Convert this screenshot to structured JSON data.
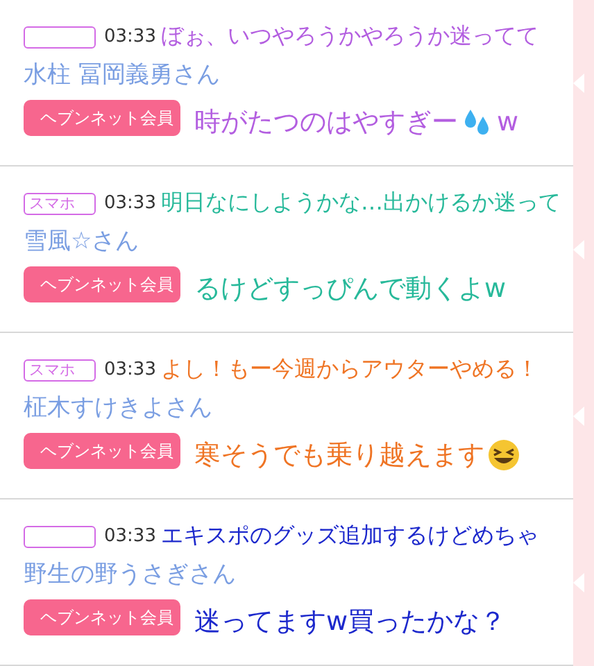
{
  "rows": [
    {
      "badge": null,
      "time": "03:33",
      "name": "水柱 冨岡義勇さん",
      "button": "ヘブンネット会員",
      "color": "#b35ee0",
      "overlay": [
        {
          "kind": "plain",
          "text": "ぼぉ、いつやろうかやろうか迷ってて"
        },
        {
          "kind": "droplets",
          "text": "時がたつのはやすぎー",
          "after": "w"
        }
      ]
    },
    {
      "badge": "スマホ",
      "time": "03:33",
      "name": "雪風☆さん",
      "button": "ヘブンネット会員",
      "color": "#27b99a",
      "overlay": [
        {
          "kind": "plain",
          "text": "明日なにしようかな…出かけるか迷って"
        },
        {
          "kind": "plain",
          "text": "るけどすっぴんで動くよw"
        }
      ]
    },
    {
      "badge": "スマホ",
      "time": "03:33",
      "name": "柾木すけきよさん",
      "button": "ヘブンネット会員",
      "color": "#ef7424",
      "overlay": [
        {
          "kind": "plain",
          "text": "よし！もー今週からアウターやめる！"
        },
        {
          "kind": "grin",
          "text": "寒そうでも乗り越えます"
        }
      ]
    },
    {
      "badge": null,
      "time": "03:33",
      "name": "野生の野うさぎさん",
      "button": "ヘブンネット会員",
      "color": "#1c28cc",
      "overlay": [
        {
          "kind": "plain",
          "text": "エキスポのグッズ追加するけどめちゃ"
        },
        {
          "kind": "plain",
          "text": "迷ってますw買ったかな？"
        }
      ]
    }
  ]
}
